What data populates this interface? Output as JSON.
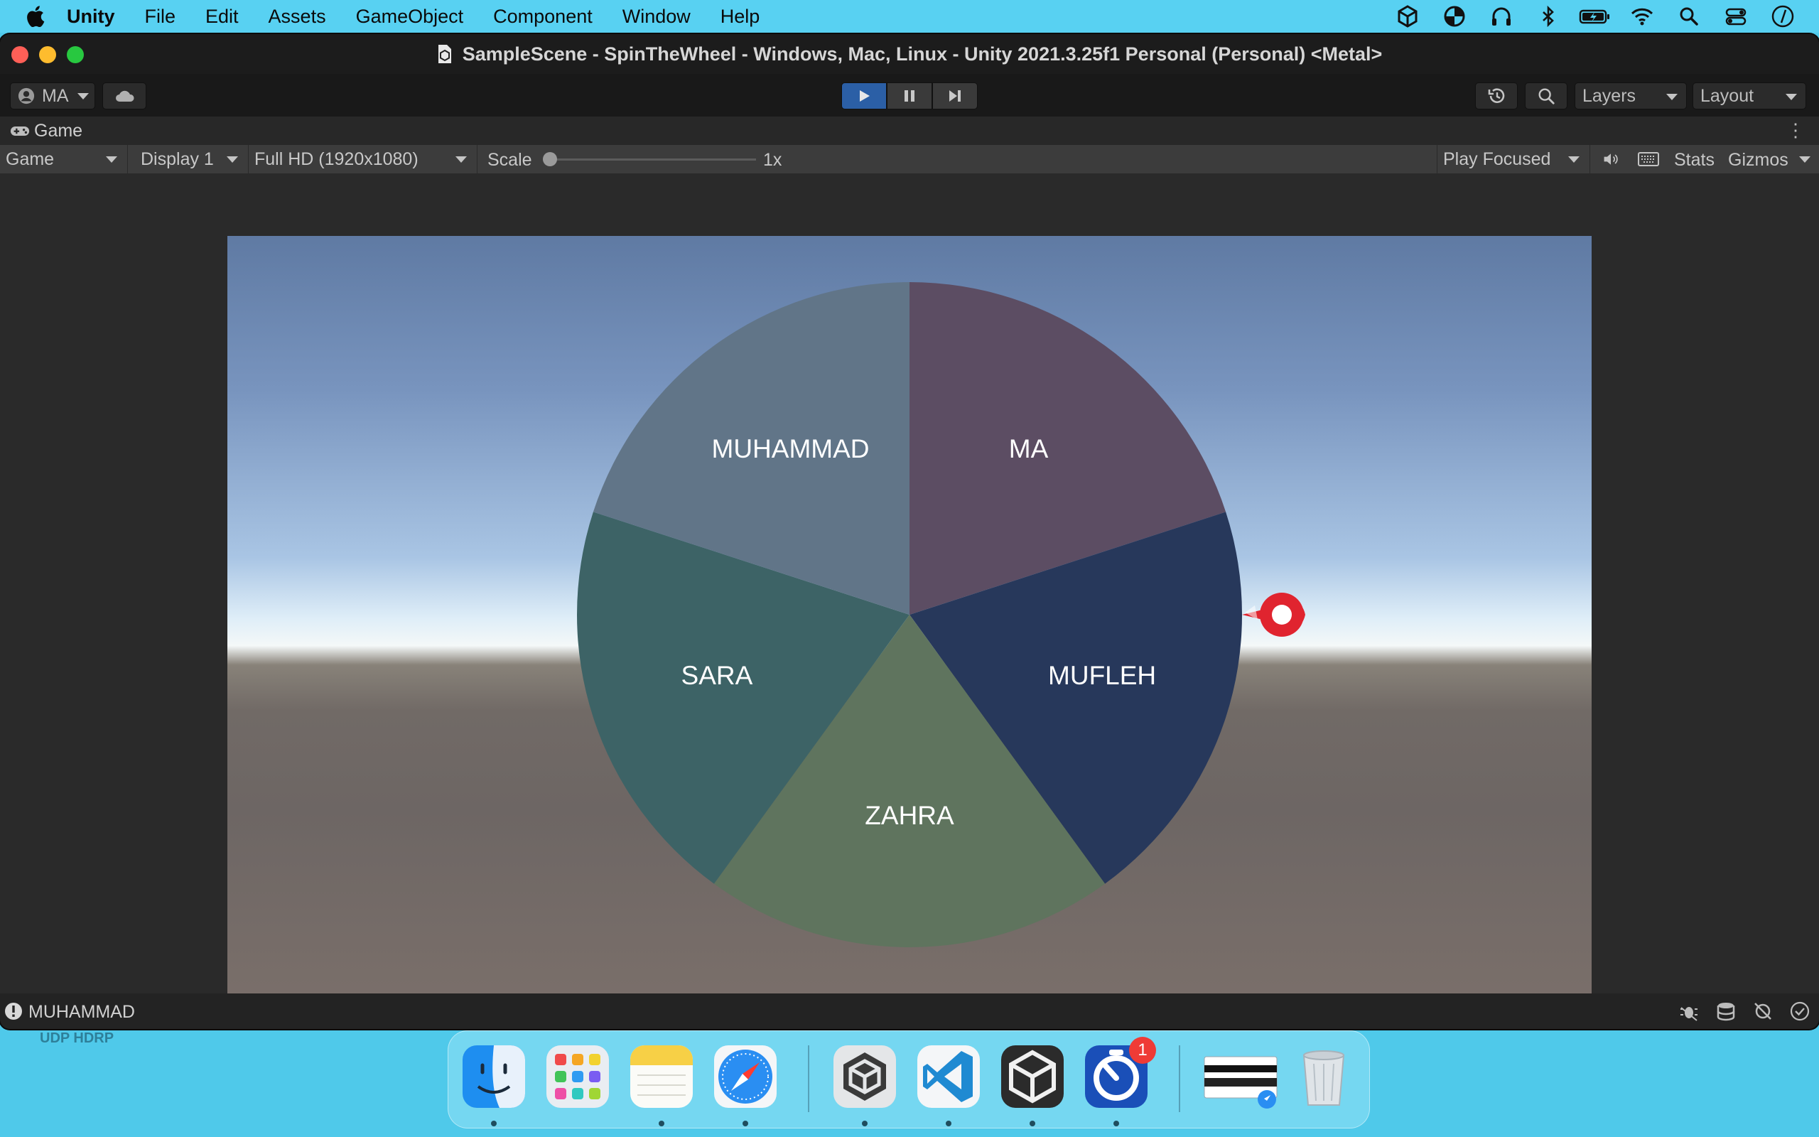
{
  "menubar": {
    "app_name": "Unity",
    "items": [
      "File",
      "Edit",
      "Assets",
      "GameObject",
      "Component",
      "Window",
      "Help"
    ],
    "status_icons": [
      "unity-hub-icon",
      "color-wheel-icon",
      "headphones-icon",
      "bluetooth-icon",
      "battery-icon",
      "wifi-icon",
      "spotlight-search-icon",
      "control-center-icon",
      "clock-icon"
    ]
  },
  "window": {
    "title": "SampleScene - SpinTheWheel - Windows, Mac, Linux - Unity 2021.3.25f1 Personal (Personal) <Metal>"
  },
  "toolbar": {
    "account_label": "MA",
    "layers_label": "Layers",
    "layout_label": "Layout"
  },
  "game_tab": {
    "title": "Game",
    "view_select": "Game",
    "display_select": "Display 1",
    "resolution_select": "Full HD (1920x1080)",
    "scale_label": "Scale",
    "scale_value": "1x",
    "scale_slider_value": 0.0,
    "play_mode_select": "Play Focused",
    "stats_label": "Stats",
    "gizmos_label": "Gizmos"
  },
  "wheel": {
    "slices": [
      {
        "label": "MA",
        "color": "#5c4d63"
      },
      {
        "label": "MUFLEH",
        "color": "#27385b"
      },
      {
        "label": "ZAHRA",
        "color": "#5f745e"
      },
      {
        "label": "SARA",
        "color": "#3d6366"
      },
      {
        "label": "MUHAMMAD",
        "color": "#617588"
      }
    ],
    "pointer_color": "#e0242f"
  },
  "statusbar": {
    "message": "MUHAMMAD"
  },
  "desktop": {
    "label": "UDP HDRP"
  },
  "dock": {
    "badge_count": "1"
  }
}
